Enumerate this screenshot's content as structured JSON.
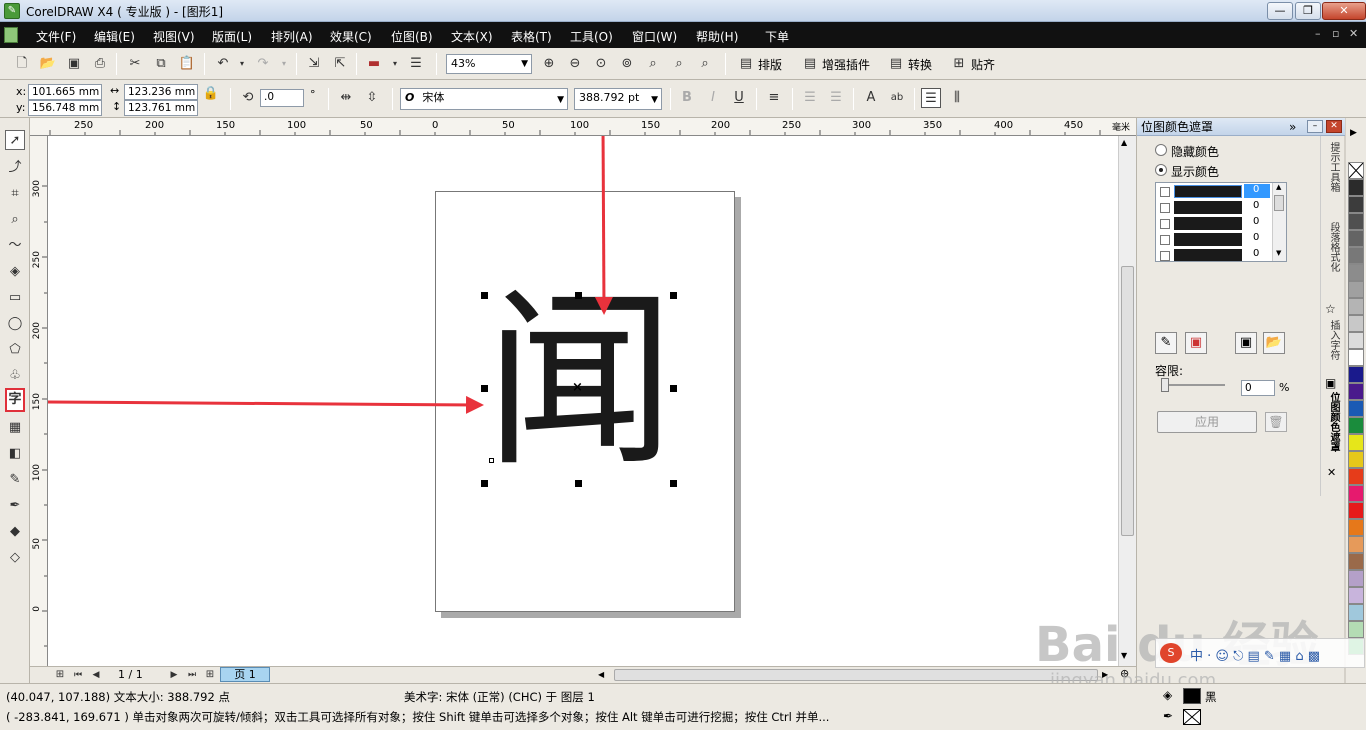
{
  "window": {
    "title": "CorelDRAW X4 ( 专业版 ) - [图形1]"
  },
  "menu": [
    "文件(F)",
    "编辑(E)",
    "视图(V)",
    "版面(L)",
    "排列(A)",
    "效果(C)",
    "位图(B)",
    "文本(X)",
    "表格(T)",
    "工具(O)",
    "窗口(W)",
    "帮助(H)",
    "下单"
  ],
  "toolbar1": {
    "zoom": "43%",
    "buttons": [
      "排版",
      "增强插件",
      "转换",
      "贴齐"
    ]
  },
  "property_bar": {
    "x_label": "x:",
    "x": "101.665 mm",
    "y_label": "y:",
    "y": "156.748 mm",
    "width": "123.236 mm",
    "height": "123.761 mm",
    "rotation": ".0",
    "rotation_unit": "°",
    "font": "宋体",
    "font_size": "388.792 pt"
  },
  "ruler": {
    "h_labels": [
      "250",
      "200",
      "150",
      "100",
      "50",
      "0",
      "50",
      "100",
      "150",
      "200",
      "250",
      "300",
      "350",
      "400",
      "450"
    ],
    "h_unit": "毫米",
    "v_labels": [
      "300",
      "250",
      "200",
      "150",
      "100",
      "50",
      "0"
    ]
  },
  "canvas": {
    "glyph": "闻"
  },
  "page_nav": {
    "counter": "1 / 1",
    "tab": "页 1"
  },
  "docker": {
    "title": "位图颜色遮罩",
    "radio_hide": "隐藏颜色",
    "radio_show": "显示颜色",
    "color_rows": [
      "0",
      "0",
      "0",
      "0",
      "0"
    ],
    "tolerance_label": "容限:",
    "tolerance_value": "0",
    "tolerance_unit": "%",
    "apply": "应用",
    "side_tabs": [
      "提示工具箱",
      "段落格式化",
      "插入字符",
      "位图颜色遮罩"
    ]
  },
  "status": {
    "line1_left": "(40.047, 107.188)  文本大小: 388.792 点",
    "line1_mid": "美术字:  宋体 (正常) (CHC) 于 图层 1",
    "line2": "( -283.841, 169.671 )   单击对象两次可旋转/倾斜；双击工具可选择所有对象；按住 Shift 键单击可选择多个对象；按住 Alt 键单击可进行挖掘；按住 Ctrl 并单...",
    "fill_label": "黑"
  },
  "palette_colors": [
    "#ffffff",
    "#2b2b2b",
    "#3c3c3c",
    "#505050",
    "#646464",
    "#787878",
    "#8c8c8c",
    "#a0a0a0",
    "#b4b4b4",
    "#c8c8c8",
    "#dcdcdc",
    "#ffffff",
    "#1a1a8c",
    "#4a1a8c",
    "#1a5ab4",
    "#1a8c3c",
    "#e6e61a",
    "#e6c81a",
    "#e63c1a",
    "#e61a6e",
    "#e61a1a",
    "#e6781a",
    "#e69a5a",
    "#9a6a4a",
    "#b4a0c8",
    "#c8b4dc",
    "#a0c8dc",
    "#b4dcb4"
  ],
  "watermark": {
    "main": "Bai du 经验",
    "sub": "jingyan.baidu.com"
  }
}
